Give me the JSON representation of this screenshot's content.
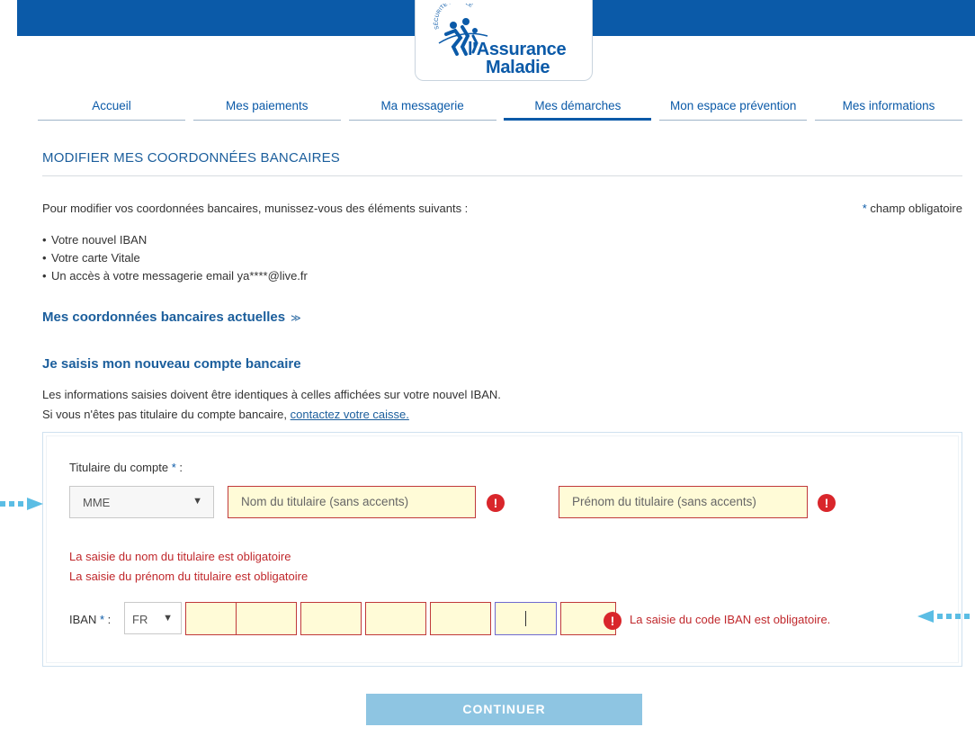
{
  "header": {
    "brand_line1": "l'Assurance",
    "brand_line2": "Maladie",
    "brand_seal": "SÉCURITÉ SOCIALE"
  },
  "nav": {
    "items": [
      {
        "label": "Accueil",
        "active": false
      },
      {
        "label": "Mes paiements",
        "active": false
      },
      {
        "label": "Ma messagerie",
        "active": false
      },
      {
        "label": "Mes démarches",
        "active": true
      },
      {
        "label": "Mon espace prévention",
        "active": false
      },
      {
        "label": "Mes informations",
        "active": false
      }
    ]
  },
  "page": {
    "title": "MODIFIER MES COORDONNÉES BANCAIRES",
    "intro": "Pour modifier vos coordonnées bancaires, munissez-vous des éléments suivants :",
    "required_note": "champ obligatoire",
    "required_star": "*",
    "bullets": [
      "Votre nouvel IBAN",
      "Votre carte Vitale",
      "Un accès à votre messagerie email ya****@live.fr"
    ],
    "current_accounts_link": "Mes coordonnées bancaires actuelles",
    "current_accounts_chevron": "≫",
    "new_account_title": "Je saisis mon nouveau compte bancaire",
    "info_line1": "Les informations saisies doivent être identiques à celles affichées sur votre nouvel IBAN.",
    "info_line2_prefix": "Si vous n'êtes pas titulaire du compte bancaire, ",
    "info_line2_link": "contactez votre caisse."
  },
  "form": {
    "holder_label": "Titulaire du compte",
    "holder_label_suffix": " :",
    "civility_value": "MME",
    "lastname_placeholder": "Nom du titulaire (sans accents)",
    "firstname_placeholder": "Prénom du titulaire (sans accents)",
    "error_lastname": "La saisie du nom du titulaire est obligatoire",
    "error_firstname": "La saisie du prénom du titulaire est obligatoire",
    "iban_label": "IBAN",
    "iban_label_suffix": " :",
    "iban_country": "FR",
    "iban_blocks": [
      "",
      "",
      "",
      "",
      "",
      "",
      ""
    ],
    "iban_focused_index": 5,
    "iban_error": "La saisie du code IBAN est obligatoire.",
    "error_icon": "!",
    "caret": "▼"
  },
  "actions": {
    "continue_label": "CONTINUER"
  },
  "colors": {
    "brand_blue": "#0b5aa8",
    "error_red": "#c0282c",
    "field_bg": "#fffbd7",
    "button_bg": "#8ec5e2",
    "arrow": "#5bbde4"
  },
  "icons": {
    "left_arrow": "dotted-arrow-right-icon",
    "right_arrow": "dotted-arrow-left-icon",
    "error": "exclamation-circle-icon",
    "chevron": "double-chevron-down-icon"
  }
}
